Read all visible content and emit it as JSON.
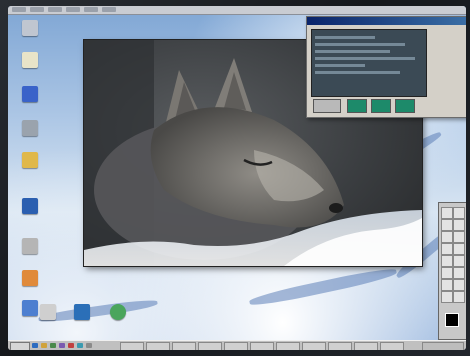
{
  "desktop": {
    "icons": [
      {
        "name": "my-computer-icon",
        "label": "",
        "color": "#c0c6d0"
      },
      {
        "name": "documents-icon",
        "label": "",
        "color": "#e9e4c8"
      },
      {
        "name": "network-icon",
        "label": "",
        "color": "#3a63c9"
      },
      {
        "name": "recycle-bin-icon",
        "label": "",
        "color": "#9aa3ad"
      },
      {
        "name": "folder-icon",
        "label": "",
        "color": "#e0b84a"
      },
      {
        "name": "app-icon",
        "label": "",
        "color": "#2b5fb0"
      },
      {
        "name": "drive-icon",
        "label": "",
        "color": "#b5b5b5"
      },
      {
        "name": "shortcut-icon",
        "label": "",
        "color": "#e08a3a"
      },
      {
        "name": "tool-icon",
        "label": "",
        "color": "#4d7fd0"
      },
      {
        "name": "printer-icon",
        "label": "",
        "color": "#cfcfcf"
      },
      {
        "name": "globe-icon",
        "label": "",
        "color": "#2b6fb8"
      },
      {
        "name": "app2-icon",
        "label": "",
        "color": "#4aa55c"
      }
    ]
  },
  "photo": {
    "subject": "sleeping-fox-photo"
  },
  "dialog": {
    "title": "",
    "buttons": [
      {
        "name": "dialog-button-1",
        "label": "",
        "color": "#1d8a6a"
      },
      {
        "name": "dialog-button-2",
        "label": "",
        "color": "#1d8a6a"
      },
      {
        "name": "dialog-button-3",
        "label": "",
        "color": "#1d8a6a"
      }
    ]
  },
  "colors": {
    "foreground": "#000000",
    "titlebar": "#0a246a"
  }
}
